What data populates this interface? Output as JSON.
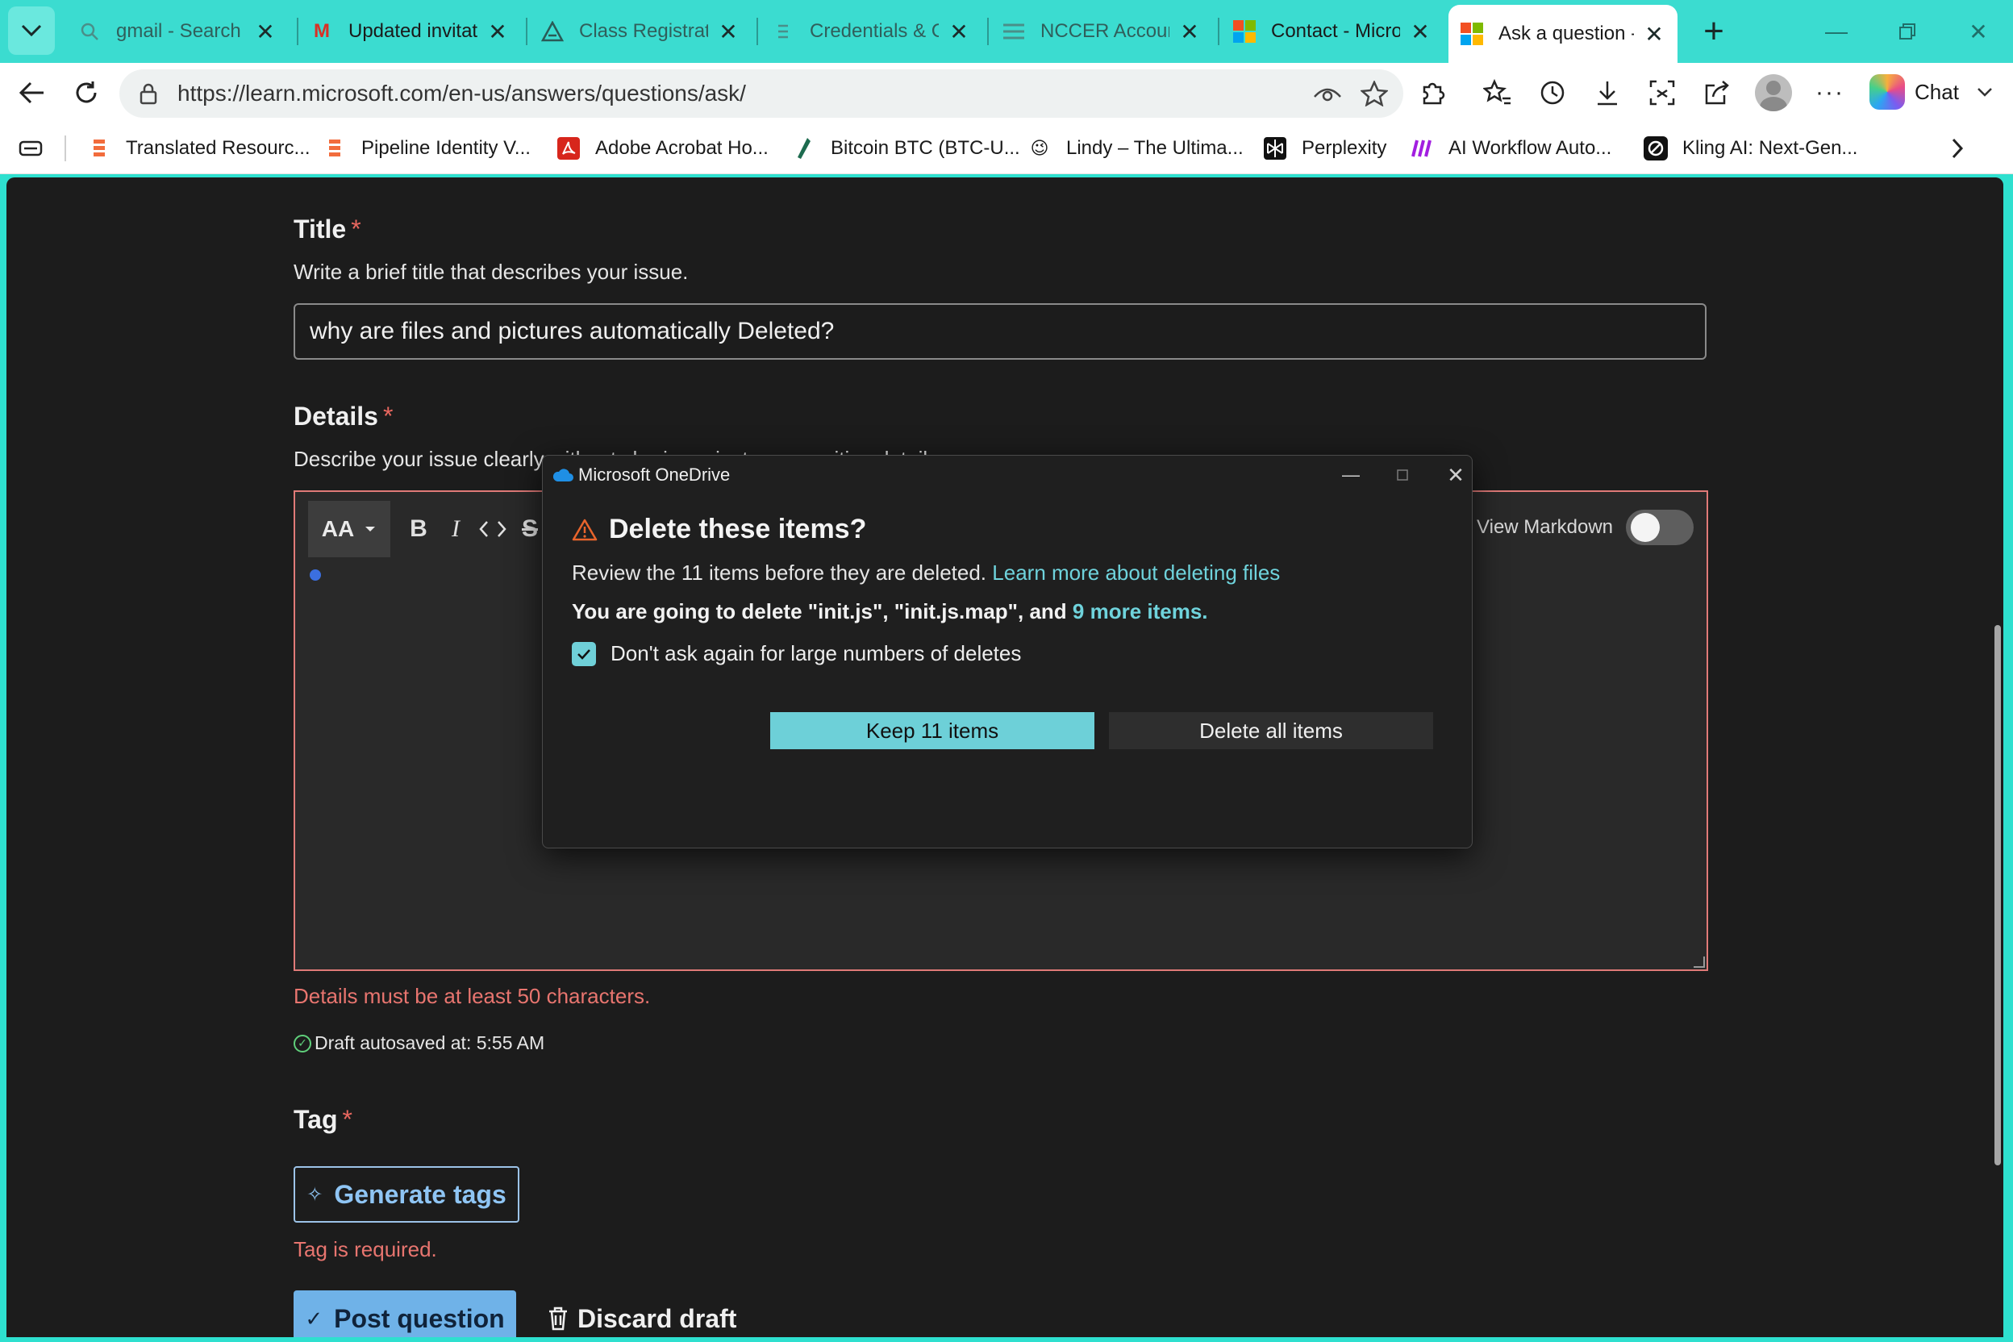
{
  "browser": {
    "tabs": [
      {
        "label": "gmail - Search",
        "icon": "search-icon"
      },
      {
        "label": "Updated invitation",
        "icon": "gmail-icon"
      },
      {
        "label": "Class Registration",
        "icon": "triangle-logo-icon"
      },
      {
        "label": "Credentials & Cer",
        "icon": "document-icon"
      },
      {
        "label": "NCCER Account P",
        "icon": "menu-lines-icon"
      },
      {
        "label": "Contact - Microso",
        "icon": "microsoft-icon"
      },
      {
        "label": "Ask a question - M",
        "icon": "microsoft-icon"
      }
    ],
    "url": "https://learn.microsoft.com/en-us/answers/questions/ask/",
    "chat_label": "Chat",
    "bookmarks": [
      {
        "label": "Translated Resourc...",
        "icon": "list-icon"
      },
      {
        "label": "Pipeline Identity V...",
        "icon": "list-icon"
      },
      {
        "label": "Adobe Acrobat Ho...",
        "icon": "adobe-icon"
      },
      {
        "label": "Bitcoin BTC (BTC-U...",
        "icon": "pen-icon"
      },
      {
        "label": "Lindy – The Ultima...",
        "icon": "lindy-icon"
      },
      {
        "label": "Perplexity",
        "icon": "perplexity-icon"
      },
      {
        "label": "AI Workflow Auto...",
        "icon": "make-icon"
      },
      {
        "label": "Kling AI: Next-Gen...",
        "icon": "kling-icon"
      }
    ]
  },
  "form": {
    "title_label": "Title",
    "required_mark": "*",
    "title_help": "Write a brief title that describes your issue.",
    "title_value": "why are files and pictures automatically Deleted?",
    "details_label": "Details",
    "details_help": "Describe your issue clearly without sharing private or sensitive details.",
    "editor_aa": "AA",
    "view_markdown": "View Markdown",
    "details_error": "Details must be at least 50 characters.",
    "autosave": "Draft autosaved at: 5:55 AM",
    "tag_label": "Tag",
    "generate_tags": "Generate tags",
    "tag_error": "Tag is required.",
    "post_question": "Post question",
    "discard_draft": "Discard draft"
  },
  "dialog": {
    "app_title": "Microsoft OneDrive",
    "heading": "Delete these items?",
    "review_text": "Review the 11 items before they are deleted.",
    "learn_more": "Learn more about deleting files",
    "going_to_delete": "You are going to delete \"init.js\", \"init.js.map\", and",
    "more_items": "9 more items.",
    "dont_ask": "Don't ask again for large numbers of deletes",
    "dont_ask_checked": true,
    "keep_button": "Keep 11 items",
    "delete_button": "Delete all items"
  },
  "colors": {
    "tabstrip": "#3bdcd0",
    "page_bg": "#1c1c1c",
    "accent_teal": "#6dd0d8",
    "error_red": "#e8756f",
    "link_blue": "#8fc5f4"
  }
}
